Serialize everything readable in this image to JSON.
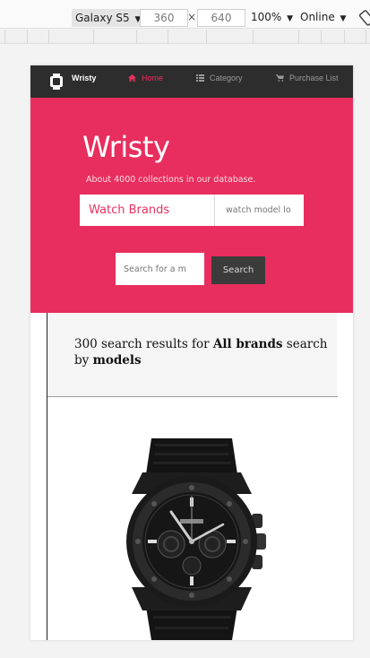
{
  "devtools": {
    "device": "Galaxy S5",
    "width": "360",
    "height": "640",
    "times": "×",
    "zoom": "100%",
    "network": "Online",
    "arrow": "▼"
  },
  "site": {
    "nav": {
      "brand": "Wristy",
      "links": [
        {
          "label": "Home",
          "icon": "home-icon",
          "active": true
        },
        {
          "label": "Category",
          "icon": "list-icon",
          "active": false
        },
        {
          "label": "Purchase List",
          "icon": "cart-icon",
          "active": false
        }
      ]
    },
    "hero": {
      "title": "Wristy",
      "subtitle": "About 4000 collections in our database.",
      "brand_select": "Watch Brands",
      "model_placeholder": "watch model lo",
      "name_placeholder": "Search for a m",
      "search_button": "Search"
    },
    "results": {
      "count_text": "300 search results for ",
      "brand_text": "All brands",
      "mid_text": " search by ",
      "mode_text": "models"
    }
  },
  "colors": {
    "accent": "#e82e5e",
    "nav_bg": "#2d2d2d",
    "button_dark": "#3b3b3b"
  }
}
